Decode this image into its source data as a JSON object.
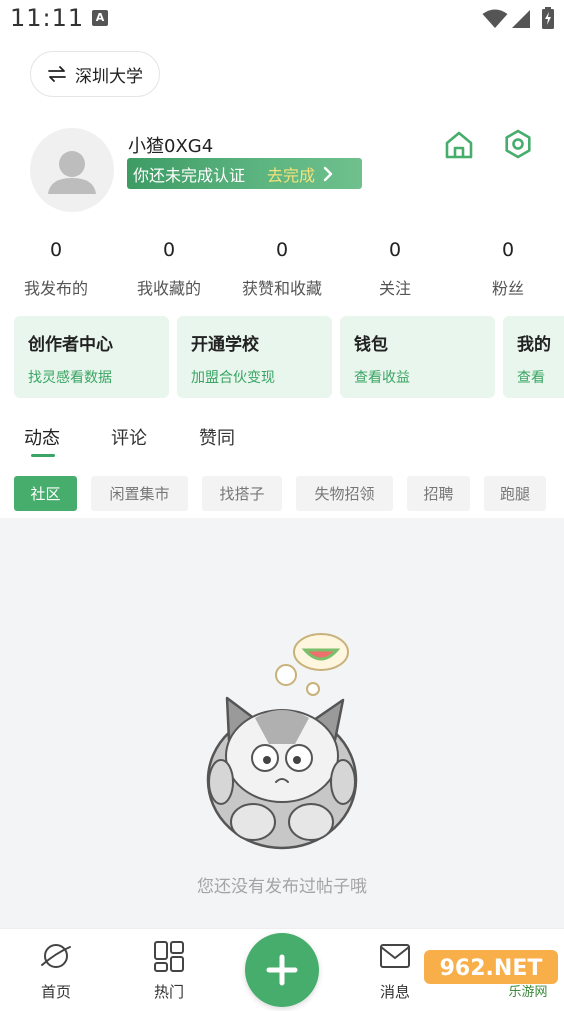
{
  "status_bar": {
    "time": "11:11",
    "notification_icon": "A"
  },
  "campus": {
    "switch_icon": "swap-icon",
    "name": "深圳大学"
  },
  "profile": {
    "username": "小猹0XG4",
    "verify_prompt": "你还未完成认证",
    "verify_action": "去完成"
  },
  "stats": [
    {
      "value": "0",
      "label": "我发布的"
    },
    {
      "value": "0",
      "label": "我收藏的"
    },
    {
      "value": "0",
      "label": "获赞和收藏"
    },
    {
      "value": "0",
      "label": "关注"
    },
    {
      "value": "0",
      "label": "粉丝"
    }
  ],
  "cards": [
    {
      "title": "创作者中心",
      "subtitle": "找灵感看数据"
    },
    {
      "title": "开通学校",
      "subtitle": "加盟合伙变现"
    },
    {
      "title": "钱包",
      "subtitle": "查看收益"
    },
    {
      "title": "我的",
      "subtitle": "查看"
    }
  ],
  "tabs": [
    {
      "label": "动态",
      "active": true
    },
    {
      "label": "评论",
      "active": false
    },
    {
      "label": "赞同",
      "active": false
    }
  ],
  "chips": [
    {
      "label": "社区",
      "active": true
    },
    {
      "label": "闲置集市",
      "active": false
    },
    {
      "label": "找搭子",
      "active": false
    },
    {
      "label": "失物招领",
      "active": false
    },
    {
      "label": "招聘",
      "active": false
    },
    {
      "label": "跑腿",
      "active": false
    }
  ],
  "empty_state": {
    "text": "您还没有发布过帖子哦"
  },
  "bottom_nav": [
    {
      "label": "首页",
      "icon": "planet-icon"
    },
    {
      "label": "热门",
      "icon": "grid-icon"
    },
    {
      "label": "消息",
      "icon": "mail-icon"
    }
  ],
  "watermark": {
    "text": "962.NET",
    "sub": "乐游网"
  },
  "colors": {
    "accent": "#46ad6c",
    "accent_text": "#3aa564",
    "card_bg": "#e9f6ed",
    "verify_action": "#f4e27a"
  }
}
